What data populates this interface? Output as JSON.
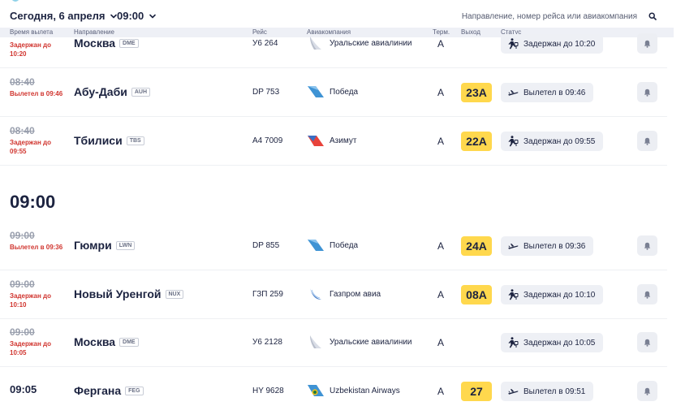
{
  "header": {
    "date_label": "Сегодня, 6 апреля",
    "time_label": "09:00",
    "search_placeholder": "Направление, номер рейса или авиакомпания"
  },
  "columns": {
    "time": "Время вылета",
    "destination": "Направление",
    "flight": "Рейс",
    "airline": "Авиакомпания",
    "terminal": "Терм.",
    "gate": "Выход",
    "status": "Статус"
  },
  "hour_heading": "09:00",
  "flights": [
    {
      "time_main": "",
      "time_old": "",
      "time_status": "Задержан до 10:20",
      "city": "Москва",
      "code": "DME",
      "flight": "У6 264",
      "airline": "Уральские авиалинии",
      "airline_icon": "ural-logo",
      "terminal": "A",
      "gate": "",
      "status": "Задержан до 10:20",
      "status_icon": "delayed-icon"
    },
    {
      "time_main": "",
      "time_old": "08:40",
      "time_status": "Вылетел в 09:46",
      "city": "Абу-Даби",
      "code": "AUH",
      "flight": "DP 753",
      "airline": "Победа",
      "airline_icon": "pobeda-logo",
      "terminal": "A",
      "gate": "23A",
      "status": "Вылетел в 09:46",
      "status_icon": "departed-icon"
    },
    {
      "time_main": "",
      "time_old": "08:40",
      "time_status": "Задержан до 09:55",
      "city": "Тбилиси",
      "code": "TBS",
      "flight": "A4 7009",
      "airline": "Азимут",
      "airline_icon": "azimut-logo",
      "terminal": "A",
      "gate": "22A",
      "status": "Задержан до 09:55",
      "status_icon": "delayed-icon"
    },
    {
      "time_main": "",
      "time_old": "09:00",
      "time_status": "Вылетел в 09:36",
      "city": "Гюмри",
      "code": "LWN",
      "flight": "DP 855",
      "airline": "Победа",
      "airline_icon": "pobeda-logo",
      "terminal": "A",
      "gate": "24A",
      "status": "Вылетел в 09:36",
      "status_icon": "departed-icon"
    },
    {
      "time_main": "",
      "time_old": "09:00",
      "time_status": "Задержан до 10:10",
      "city": "Новый Уренгой",
      "code": "NUX",
      "flight": "ГЗП 259",
      "airline": "Газпром авиа",
      "airline_icon": "gazprom-logo",
      "terminal": "A",
      "gate": "08A",
      "status": "Задержан до 10:10",
      "status_icon": "delayed-icon"
    },
    {
      "time_main": "",
      "time_old": "09:00",
      "time_status": "Задержан до 10:05",
      "city": "Москва",
      "code": "DME",
      "flight": "У6 2128",
      "airline": "Уральские авиалинии",
      "airline_icon": "ural-logo",
      "terminal": "A",
      "gate": "",
      "status": "Задержан до 10:05",
      "status_icon": "delayed-icon"
    },
    {
      "time_main": "09:05",
      "time_old": "",
      "time_status": "",
      "city": "Фергана",
      "code": "FEG",
      "flight": "HY 9628",
      "airline": "Uzbekistan Airways",
      "airline_icon": "uzbekistan-logo",
      "terminal": "A",
      "gate": "27",
      "status": "Вылетел в 09:51",
      "status_icon": "departed-icon"
    }
  ],
  "colors": {
    "gate_badge": "#ffd84d",
    "status_pill": "#eef0f5",
    "delay_text": "#d0352f",
    "primary_text": "#1c2340"
  }
}
